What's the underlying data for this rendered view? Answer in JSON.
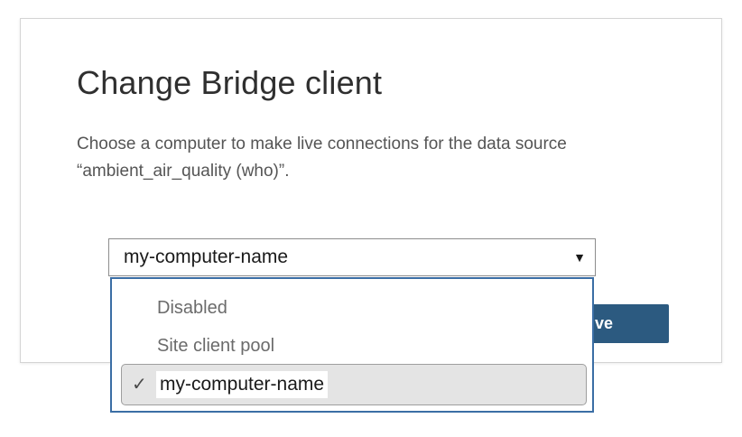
{
  "dialog": {
    "title": "Change Bridge client",
    "description_line1": "Choose a computer to make live connections for the data source",
    "description_line2": "“ambient_air_quality (who)”."
  },
  "client_select": {
    "value": "my-computer-name",
    "caret_icon": "caret-down-icon",
    "options": [
      {
        "label": "Disabled",
        "selected": false
      },
      {
        "label": "Site client pool",
        "selected": false
      },
      {
        "label": "my-computer-name",
        "selected": true
      }
    ],
    "check_glyph": "✓"
  },
  "actions": {
    "save_label": "ve"
  },
  "colors": {
    "accent": "#2c5a80",
    "dropdown_border": "#3b6ea5",
    "selected_bg": "#e4e4e4"
  }
}
